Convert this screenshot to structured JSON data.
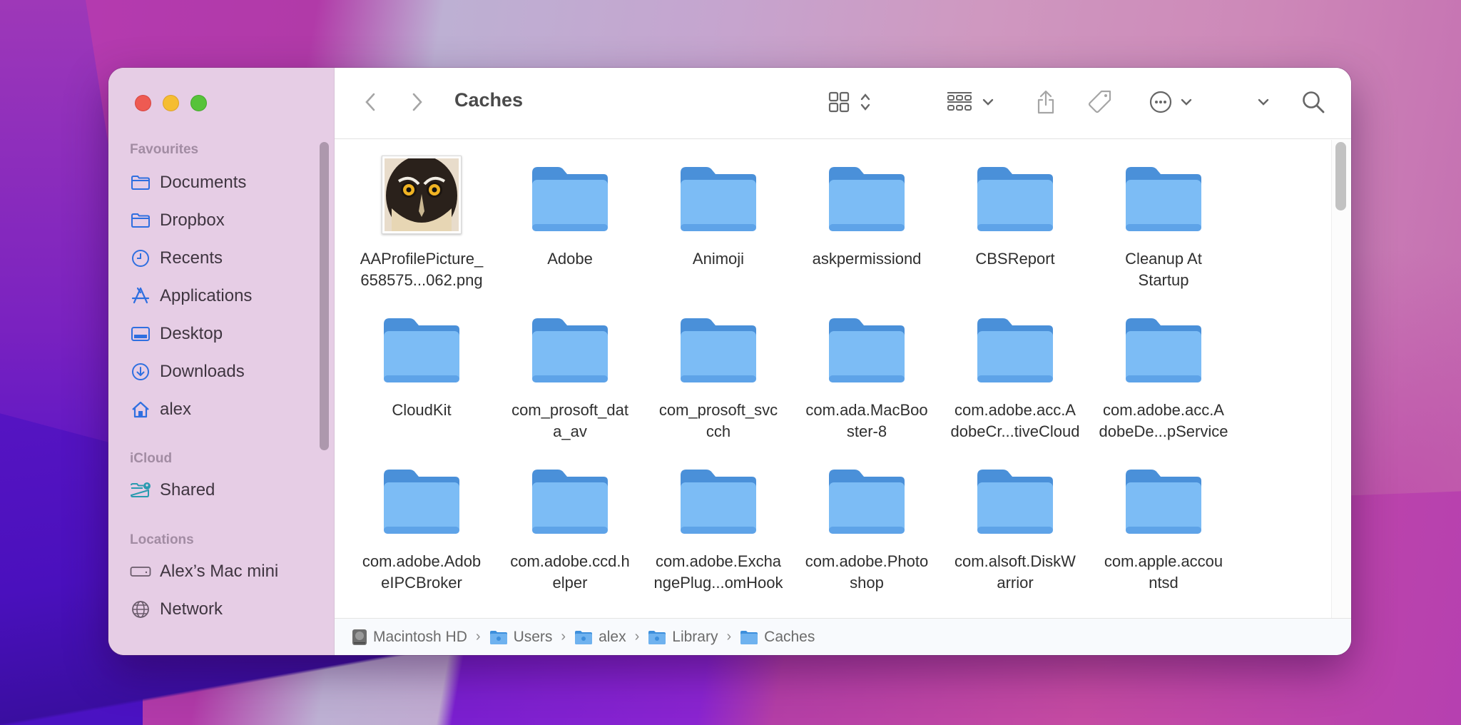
{
  "window": {
    "title": "Caches",
    "traffic_lights": [
      "close",
      "minimize",
      "zoom"
    ]
  },
  "sidebar": {
    "sections": [
      {
        "heading": "Favourites",
        "items": [
          {
            "label": "Documents",
            "icon": "folder-icon"
          },
          {
            "label": "Dropbox",
            "icon": "folder-icon"
          },
          {
            "label": "Recents",
            "icon": "clock-icon"
          },
          {
            "label": "Applications",
            "icon": "applications-icon"
          },
          {
            "label": "Desktop",
            "icon": "desktop-icon"
          },
          {
            "label": "Downloads",
            "icon": "download-icon"
          },
          {
            "label": "alex",
            "icon": "home-icon"
          }
        ]
      },
      {
        "heading": "iCloud",
        "items": [
          {
            "label": "Shared",
            "icon": "shared-folder-icon"
          }
        ]
      },
      {
        "heading": "Locations",
        "items": [
          {
            "label": "Alex’s Mac mini",
            "icon": "drive-icon"
          },
          {
            "label": "Network",
            "icon": "globe-icon"
          }
        ]
      }
    ],
    "accent_color": "#2f6fe0"
  },
  "toolbar": {
    "back_icon": "chevron-left-icon",
    "forward_icon": "chevron-right-icon",
    "view_icon": "grid-view-icon",
    "group_icon": "group-icon",
    "share_icon": "share-icon",
    "tag_icon": "tag-icon",
    "action_icon": "ellipsis-circle-icon",
    "overflow_icon": "chevron-down-icon",
    "search_icon": "search-icon"
  },
  "files": [
    {
      "name": "AAProfilePicture_\n658575...062.png",
      "type": "image"
    },
    {
      "name": "Adobe",
      "type": "folder"
    },
    {
      "name": "Animoji",
      "type": "folder"
    },
    {
      "name": "askpermissiond",
      "type": "folder"
    },
    {
      "name": "CBSReport",
      "type": "folder"
    },
    {
      "name": "Cleanup At\nStartup",
      "type": "folder"
    },
    {
      "name": "CloudKit",
      "type": "folder"
    },
    {
      "name": "com_prosoft_dat\na_av",
      "type": "folder"
    },
    {
      "name": "com_prosoft_svc\ncch",
      "type": "folder"
    },
    {
      "name": "com.ada.MacBoo\nster-8",
      "type": "folder"
    },
    {
      "name": "com.adobe.acc.A\ndobeCr...tiveCloud",
      "type": "folder"
    },
    {
      "name": "com.adobe.acc.A\ndobeDe...pService",
      "type": "folder"
    },
    {
      "name": "com.adobe.Adob\neIPCBroker",
      "type": "folder"
    },
    {
      "name": "com.adobe.ccd.h\nelper",
      "type": "folder"
    },
    {
      "name": "com.adobe.Excha\nngePlug...omHook",
      "type": "folder"
    },
    {
      "name": "com.adobe.Photo\nshop",
      "type": "folder"
    },
    {
      "name": "com.alsoft.DiskW\narrior",
      "type": "folder"
    },
    {
      "name": "com.apple.accou\nntsd",
      "type": "folder"
    }
  ],
  "pathbar": [
    {
      "label": "Macintosh HD",
      "icon": "hard-drive-icon"
    },
    {
      "label": "Users",
      "icon": "users-folder-icon"
    },
    {
      "label": "alex",
      "icon": "home-folder-icon"
    },
    {
      "label": "Library",
      "icon": "library-folder-icon"
    },
    {
      "label": "Caches",
      "icon": "folder-icon"
    }
  ],
  "pathbar_separator": "›"
}
